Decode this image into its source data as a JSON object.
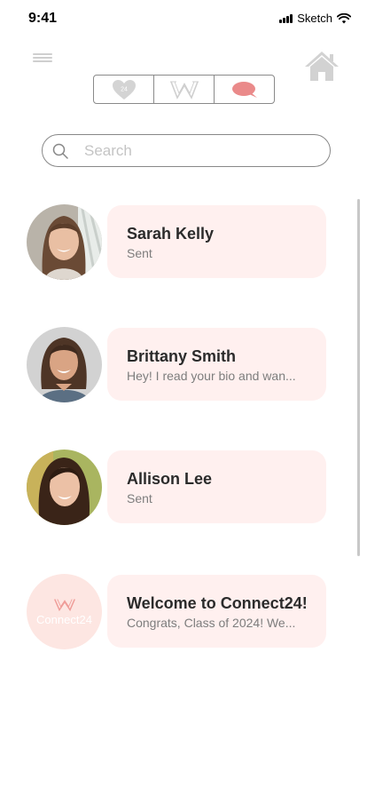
{
  "status_bar": {
    "time": "9:41",
    "carrier": "Sketch"
  },
  "nav": {
    "tabs": [
      {
        "name": "matches",
        "badge": "24",
        "icon": "heart-icon"
      },
      {
        "name": "logo",
        "icon": "w-logo-icon"
      },
      {
        "name": "messages",
        "icon": "chat-bubble-icon",
        "active": true
      }
    ]
  },
  "search": {
    "placeholder": "Search",
    "value": ""
  },
  "messages": [
    {
      "name": "Sarah Kelly",
      "preview": "Sent"
    },
    {
      "name": "Brittany Smith",
      "preview": "Hey! I read your bio and wan..."
    },
    {
      "name": "Allison Lee",
      "preview": "Sent"
    },
    {
      "name": "Welcome to Connect24!",
      "preview": "Congrats, Class of 2024! We...",
      "avatar_logo_text": "Connect24"
    }
  ],
  "colors": {
    "bubble": "#fff0ef",
    "accent": "#ea8a8a",
    "icon_gray": "#d4d4d4"
  }
}
